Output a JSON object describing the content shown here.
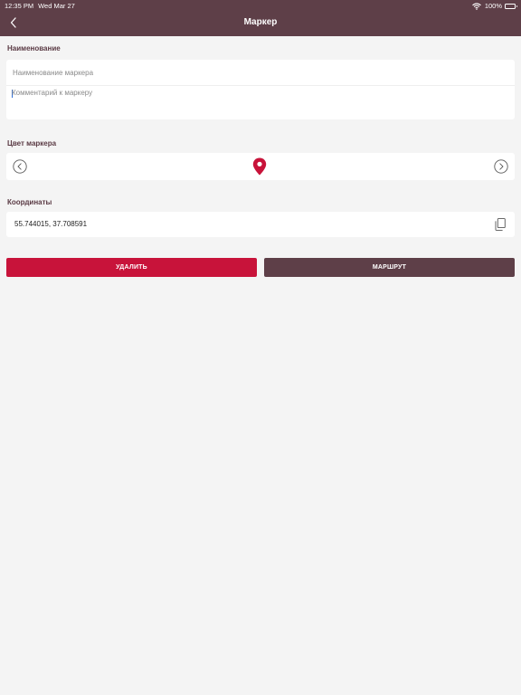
{
  "status_bar": {
    "time": "12:35 PM",
    "date": "Wed Mar 27",
    "battery": "100%"
  },
  "nav": {
    "title": "Маркер",
    "back_icon": "chevron-left-icon"
  },
  "name_section": {
    "label": "Наименование",
    "name_value": "",
    "name_placeholder": "Наименование маркера",
    "comment_value": "",
    "comment_placeholder": "Комментарий к маркеру"
  },
  "color_section": {
    "label": "Цвет маркера",
    "marker_color": "#c8133a",
    "prev_icon": "chevron-left-circle-icon",
    "next_icon": "chevron-right-circle-icon"
  },
  "coords_section": {
    "label": "Координаты",
    "value": "55.744015, 37.708591",
    "copy_icon": "copy-icon"
  },
  "actions": {
    "delete_label": "УДАЛИТЬ",
    "route_label": "МАРШРУТ"
  },
  "colors": {
    "header_bg": "#5e3f48",
    "delete_bg": "#c8133a",
    "route_bg": "#5e3f48",
    "page_bg": "#f4f4f4"
  }
}
